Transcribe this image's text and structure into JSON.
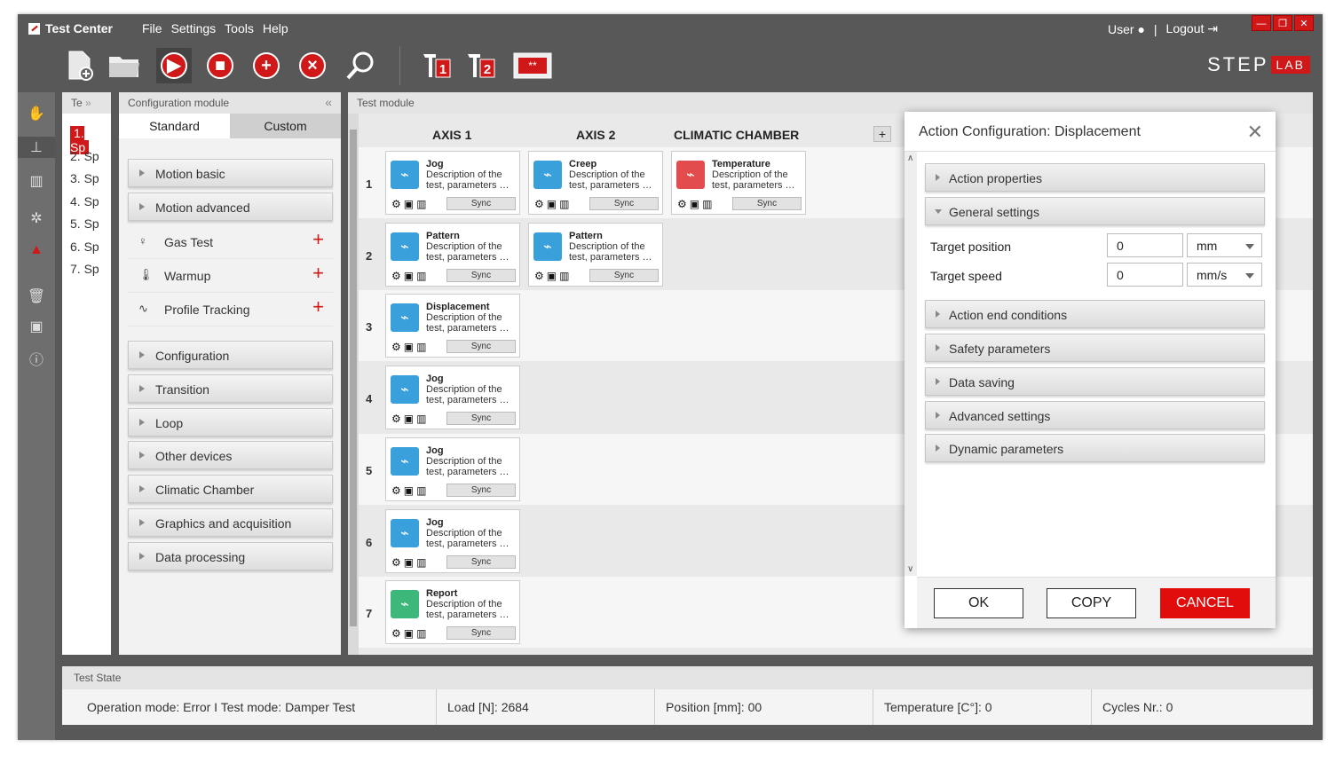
{
  "app": {
    "title": "Test Center",
    "menu": [
      "File",
      "Settings",
      "Tools",
      "Help"
    ],
    "user": "User",
    "logout": "Logout",
    "brand_left": "STEP",
    "brand_right": "LAB",
    "window_buttons": [
      "—",
      "❐",
      "✕"
    ]
  },
  "toolbar": [
    {
      "name": "new-test",
      "icon": "new-file-icon"
    },
    {
      "name": "open",
      "icon": "folder-icon"
    },
    {
      "name": "play",
      "icon": "play-icon"
    },
    {
      "name": "stop",
      "icon": "stop-icon"
    },
    {
      "name": "add",
      "icon": "plus-icon"
    },
    {
      "name": "cancel",
      "icon": "x-icon"
    },
    {
      "name": "search",
      "icon": "search-icon"
    },
    {
      "name": "probe-1",
      "label": "1"
    },
    {
      "name": "probe-2",
      "label": "2"
    },
    {
      "name": "climatic-display",
      "label": "**"
    }
  ],
  "te_panel": {
    "header": "Te",
    "items": [
      "1. Sp",
      "2. Sp",
      "3. Sp",
      "4. Sp",
      "5. Sp",
      "6. Sp",
      "7. Sp"
    ],
    "selected": 0
  },
  "config": {
    "header": "Configuration module",
    "tabs": [
      "Standard",
      "Custom"
    ],
    "active_tab": 0,
    "groups_top": [
      "Motion basic",
      "Motion advanced"
    ],
    "subitems": [
      {
        "label": "Gas Test",
        "icon": "gas-icon"
      },
      {
        "label": "Warmup",
        "icon": "thermometer-icon"
      },
      {
        "label": "Profile Tracking",
        "icon": "wave-icon"
      }
    ],
    "groups_bottom": [
      "Configuration",
      "Transition",
      "Loop",
      "Other devices",
      "Climatic Chamber",
      "Graphics and acquisition",
      "Data processing"
    ]
  },
  "test": {
    "header": "Test module",
    "columns": [
      "AXIS 1",
      "AXIS 2",
      "CLIMATIC CHAMBER"
    ],
    "add_label": "+",
    "sync_label": "Sync",
    "rows": [
      {
        "num": "1",
        "cards": [
          {
            "title": "Jog",
            "desc": "Description of the test, parameters …",
            "color": "#3aa0dc"
          },
          {
            "title": "Creep",
            "desc": "Description of the test, parameters …",
            "color": "#3aa0dc"
          },
          {
            "title": "Temperature",
            "desc": "Description of the test, parameters …",
            "color": "#e24c4c"
          }
        ]
      },
      {
        "num": "2",
        "cards": [
          {
            "title": "Pattern",
            "desc": "Description of the test, parameters …",
            "color": "#3aa0dc"
          },
          {
            "title": "Pattern",
            "desc": "Description of the test, parameters …",
            "color": "#3aa0dc"
          }
        ]
      },
      {
        "num": "3",
        "cards": [
          {
            "title": "Displacement",
            "desc": "Description of the test, parameters …",
            "color": "#3aa0dc"
          }
        ]
      },
      {
        "num": "4",
        "cards": [
          {
            "title": "Jog",
            "desc": "Description of the test, parameters …",
            "color": "#3aa0dc"
          }
        ]
      },
      {
        "num": "5",
        "cards": [
          {
            "title": "Jog",
            "desc": "Description of the test, parameters …",
            "color": "#3aa0dc"
          }
        ]
      },
      {
        "num": "6",
        "cards": [
          {
            "title": "Jog",
            "desc": "Description of the test, parameters …",
            "color": "#3aa0dc"
          }
        ]
      },
      {
        "num": "7",
        "cards": [
          {
            "title": "Report",
            "desc": "Description of the test, parameters …",
            "color": "#3db77a"
          }
        ]
      }
    ]
  },
  "dialog": {
    "title": "Action Configuration: Displacement",
    "sections_top": [
      "Action properties",
      "General settings"
    ],
    "fields": [
      {
        "label": "Target position",
        "value": "0",
        "unit": "mm"
      },
      {
        "label": "Target speed",
        "value": "0",
        "unit": "mm/s"
      }
    ],
    "sections_bottom": [
      "Action end conditions",
      "Safety parameters",
      "Data saving",
      "Advanced settings",
      "Dynamic parameters"
    ],
    "buttons": {
      "ok": "OK",
      "copy": "COPY",
      "cancel": "CANCEL"
    }
  },
  "state": {
    "header": "Test State",
    "items": [
      "Operation mode: Error I Test mode: Damper Test",
      "Load [N]: 2684",
      "Position [mm]: 00",
      "Temperature [C°]: 0",
      "Cycles Nr.: 0"
    ]
  },
  "colors": {
    "accent": "#d01818",
    "chrome": "#585858",
    "card_blue": "#3aa0dc",
    "card_red": "#e24c4c",
    "card_green": "#3db77a"
  }
}
